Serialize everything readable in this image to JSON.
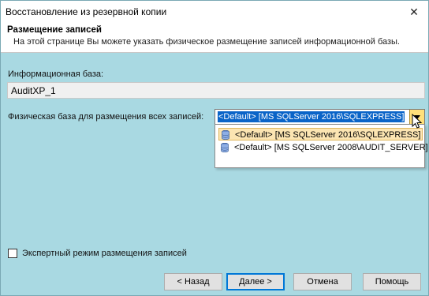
{
  "window": {
    "title": "Восстановление из резервной копии"
  },
  "header": {
    "title": "Размещение записей",
    "subtitle": "На этой странице Вы можете указать физическое размещение записей информационной базы."
  },
  "infobase": {
    "label": "Информационная база:",
    "value": "AuditXP_1"
  },
  "physical": {
    "label": "Физическая база для размещения всех записей:",
    "selected": "<Default> [MS SQLServer 2016\\SQLEXPRESS]",
    "options": [
      "<Default> [MS SQLServer 2016\\SQLEXPRESS]",
      "<Default> [MS SQLServer 2008\\AUDIT_SERVER]"
    ]
  },
  "expert_mode": {
    "label": "Экспертный режим размещения записей",
    "checked": false
  },
  "buttons": {
    "back": "< Назад",
    "next": "Далее >",
    "cancel": "Отмена",
    "help": "Помощь"
  },
  "colors": {
    "background": "#a9d9e2",
    "selection": "#0a64c8",
    "highlight": "#fce5b2"
  }
}
